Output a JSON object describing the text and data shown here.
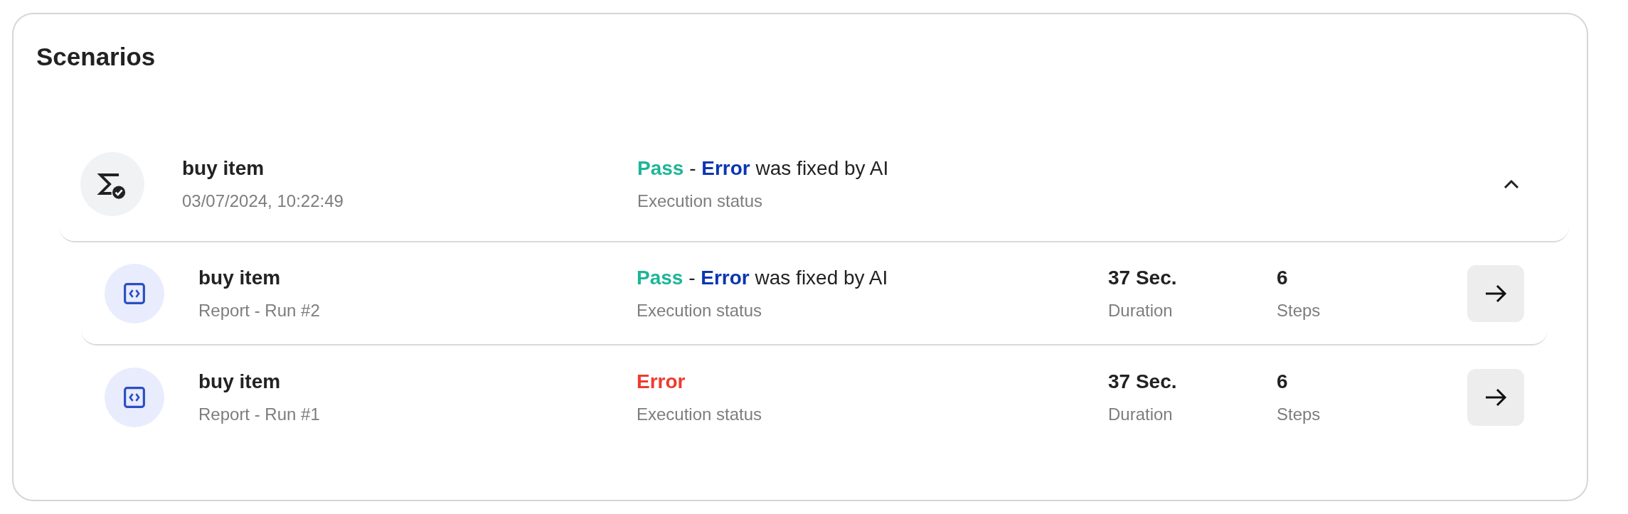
{
  "title": "Scenarios",
  "scenario": {
    "name": "buy item",
    "date": "03/07/2024, 10:22:49",
    "expanded": true,
    "status": [
      {
        "text": "Pass",
        "kind": "pass"
      },
      {
        "text": " - ",
        "kind": "plain"
      },
      {
        "text": "Error",
        "kind": "fixed"
      },
      {
        "text": " was fixed by AI",
        "kind": "plain"
      }
    ],
    "status_label": "Execution status"
  },
  "runs": [
    {
      "name": "buy item",
      "report": "Report - Run #2",
      "status": [
        {
          "text": "Pass",
          "kind": "pass"
        },
        {
          "text": " - ",
          "kind": "plain"
        },
        {
          "text": "Error",
          "kind": "fixed"
        },
        {
          "text": " was fixed by AI",
          "kind": "plain"
        }
      ],
      "status_label": "Execution status",
      "duration": "37 Sec.",
      "duration_label": "Duration",
      "steps": "6",
      "steps_label": "Steps"
    },
    {
      "name": "buy item",
      "report": "Report - Run #1",
      "status": [
        {
          "text": "Error",
          "kind": "error"
        }
      ],
      "status_label": "Execution status",
      "duration": "37 Sec.",
      "duration_label": "Duration",
      "steps": "6",
      "steps_label": "Steps"
    }
  ]
}
